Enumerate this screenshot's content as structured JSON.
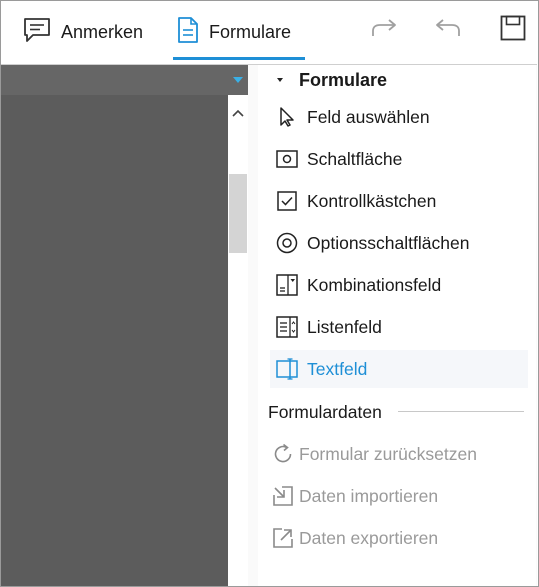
{
  "toolbar": {
    "tabs": [
      {
        "label": "Anmerken",
        "icon": "comment-icon",
        "active": false
      },
      {
        "label": "Formulare",
        "icon": "form-document-icon",
        "active": true
      }
    ],
    "accent_color": "#1e8fd6",
    "actions": [
      "redo-icon",
      "undo-icon",
      "save-icon"
    ]
  },
  "panel": {
    "section_title": "Formulare",
    "items": [
      {
        "label": "Feld auswählen",
        "icon": "pointer-icon"
      },
      {
        "label": "Schaltfläche",
        "icon": "button-field-icon"
      },
      {
        "label": "Kontrollkästchen",
        "icon": "checkbox-icon"
      },
      {
        "label": "Optionsschaltflächen",
        "icon": "radio-button-icon"
      },
      {
        "label": "Kombinationsfeld",
        "icon": "combo-box-icon"
      },
      {
        "label": "Listenfeld",
        "icon": "list-box-icon"
      },
      {
        "label": "Textfeld",
        "icon": "text-field-icon",
        "selected": true
      }
    ],
    "data_section_title": "Formulardaten",
    "data_items": [
      {
        "label": "Formular zurücksetzen",
        "icon": "reset-icon",
        "disabled": true
      },
      {
        "label": "Daten importieren",
        "icon": "import-icon",
        "disabled": true
      },
      {
        "label": "Daten exportieren",
        "icon": "export-icon",
        "disabled": true
      }
    ]
  }
}
